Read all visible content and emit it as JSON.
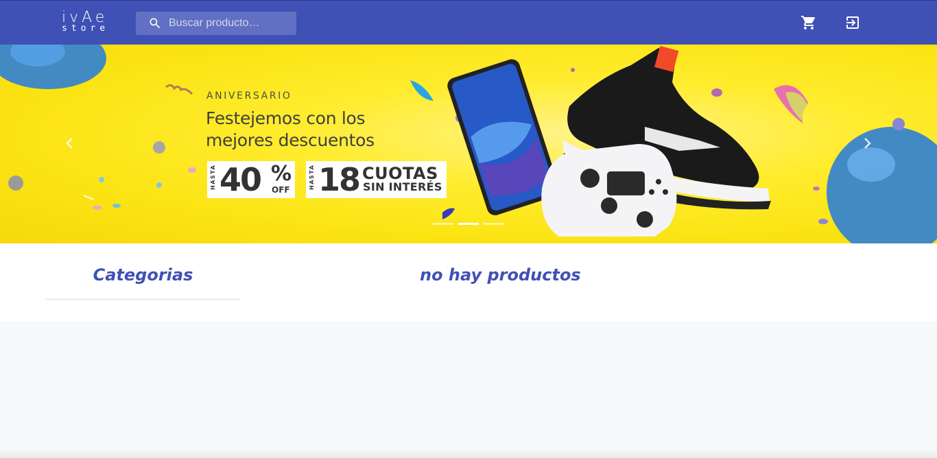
{
  "header": {
    "logo_line1": "ivAe",
    "logo_line2": "store",
    "search_placeholder": "Buscar producto…",
    "icons": [
      "search-icon",
      "cart-icon",
      "login-icon"
    ],
    "color": "#3f51b5"
  },
  "banner": {
    "kicker": "ANIVERSARIO",
    "headline": "Festejemos con los mejores descuentos",
    "promo1": {
      "prefix": "HASTA",
      "value": "40",
      "unit": "%",
      "suffix": "OFF"
    },
    "promo2": {
      "prefix": "HASTA",
      "value": "18",
      "line1": "CUOTAS",
      "line2": "SIN INTERÉS"
    },
    "background": "#ffec2e",
    "slides": 3,
    "active_slide": 2
  },
  "content": {
    "categories_title": "Categorias",
    "empty_message": "no hay productos"
  }
}
